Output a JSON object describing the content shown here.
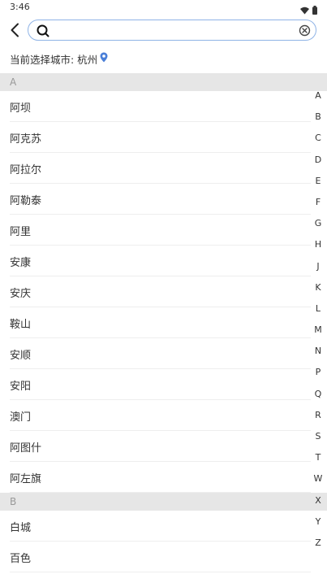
{
  "status_bar": {
    "time": "3:46"
  },
  "search": {
    "value": "",
    "placeholder": ""
  },
  "current_city": {
    "label": "当前选择城市: 杭州"
  },
  "sections": [
    {
      "letter": "A",
      "cities": [
        "阿坝",
        "阿克苏",
        "阿拉尔",
        "阿勒泰",
        "阿里",
        "安康",
        "安庆",
        "鞍山",
        "安顺",
        "安阳",
        "澳门",
        "阿图什",
        "阿左旗"
      ]
    },
    {
      "letter": "B",
      "cities": [
        "白城",
        "百色"
      ]
    }
  ],
  "alphabet": [
    "A",
    "B",
    "C",
    "D",
    "E",
    "F",
    "G",
    "H",
    "J",
    "K",
    "L",
    "M",
    "N",
    "P",
    "Q",
    "R",
    "S",
    "T",
    "W",
    "X",
    "Y",
    "Z"
  ],
  "colors": {
    "accent": "#4a7fd8",
    "section_bg": "#e6e6e6",
    "search_border": "#8fb3e6"
  }
}
